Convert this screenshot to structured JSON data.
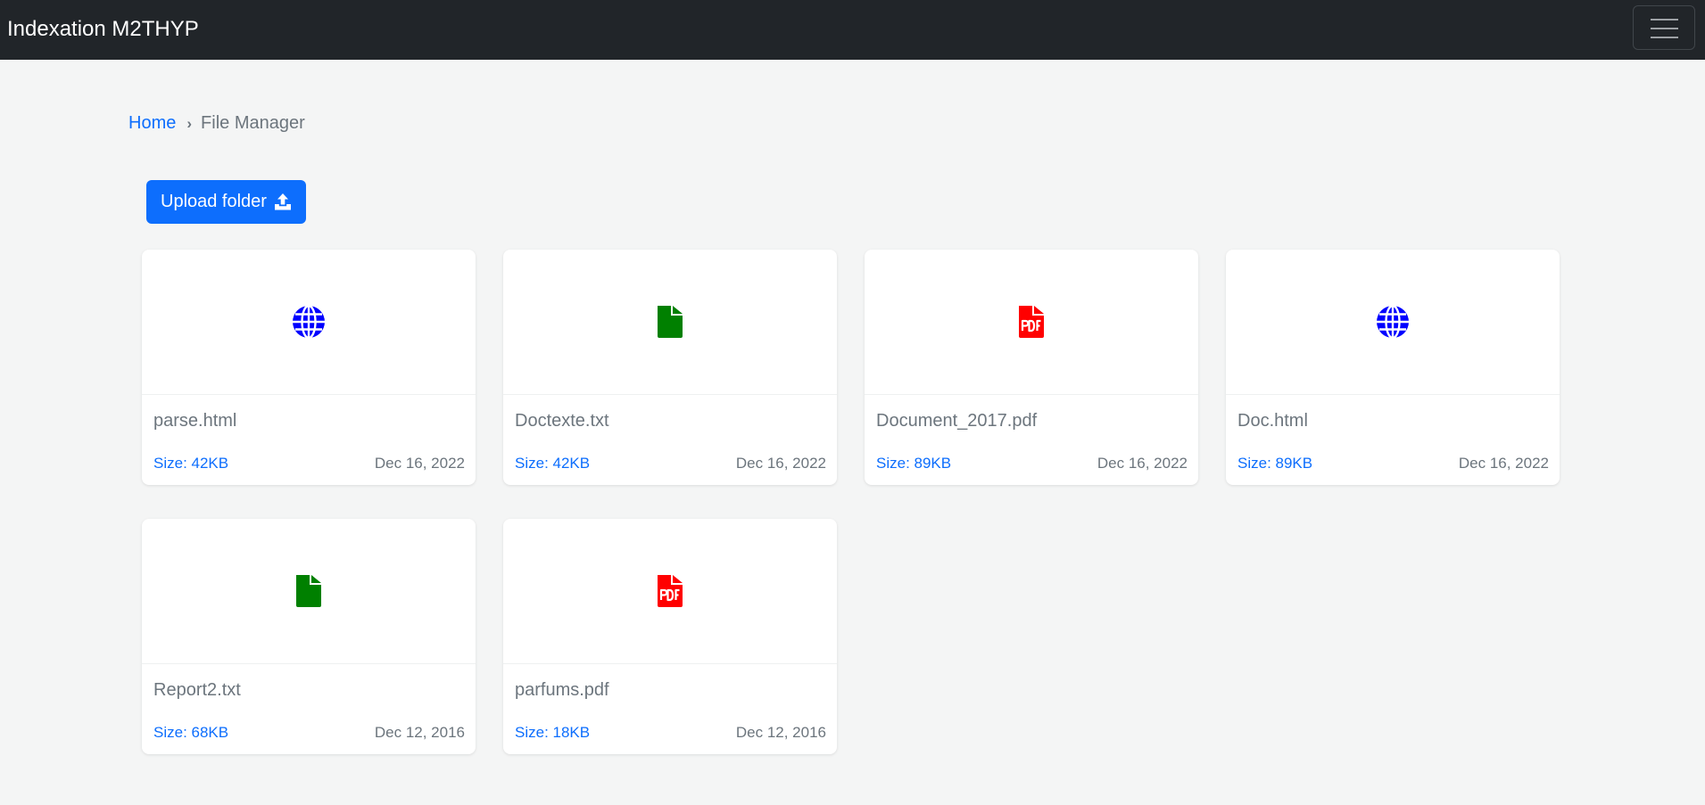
{
  "navbar": {
    "brand": "Indexation M2THYP",
    "toggle_icon": "hamburger-menu-icon"
  },
  "breadcrumb": {
    "home": "Home",
    "separator": "›",
    "current": "File Manager"
  },
  "upload": {
    "label": "Upload folder",
    "icon": "upload-icon"
  },
  "colors": {
    "accent": "#0d6efd",
    "html_icon": "#0000ff",
    "txt_icon": "#008000",
    "pdf_icon": "#ff0000",
    "navbar": "#212529"
  },
  "files": [
    {
      "name": "parse.html",
      "size": "Size: 42KB",
      "date": "Dec 16, 2022",
      "icon": "globe-icon"
    },
    {
      "name": "Doctexte.txt",
      "size": "Size: 42KB",
      "date": "Dec 16, 2022",
      "icon": "file-icon"
    },
    {
      "name": "Document_2017.pdf",
      "size": "Size: 89KB",
      "date": "Dec 16, 2022",
      "icon": "pdf-icon"
    },
    {
      "name": "Doc.html",
      "size": "Size: 89KB",
      "date": "Dec 16, 2022",
      "icon": "globe-icon"
    },
    {
      "name": "Report2.txt",
      "size": "Size: 68KB",
      "date": "Dec 12, 2016",
      "icon": "file-icon"
    },
    {
      "name": "parfums.pdf",
      "size": "Size: 18KB",
      "date": "Dec 12, 2016",
      "icon": "pdf-icon"
    }
  ]
}
